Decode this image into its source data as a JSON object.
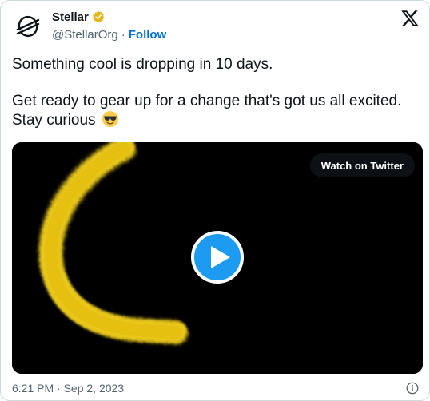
{
  "author": {
    "display_name": "Stellar",
    "handle": "@StellarOrg",
    "separator": "·",
    "follow_label": "Follow",
    "verified_color": "#e2b719",
    "avatar_icon": "stellar-logo-icon"
  },
  "brand_icon": "x-logo-icon",
  "tweet": {
    "line1": "Something cool is dropping in 10 days.",
    "line2": "Get ready to gear up for a change that's got us all excited.",
    "line3": "Stay curious",
    "emoji": "smiling-face-with-sunglasses"
  },
  "media": {
    "watch_label": "Watch on Twitter",
    "play_color": "#1d9bf0",
    "brush_color": "#f5d21a"
  },
  "footer": {
    "timestamp": "6:21 PM · Sep 2, 2023",
    "info_icon": "info-icon"
  },
  "colors": {
    "text_primary": "#0f1419",
    "text_secondary": "#536471",
    "link": "#006fd6",
    "border": "#cfd9de"
  }
}
